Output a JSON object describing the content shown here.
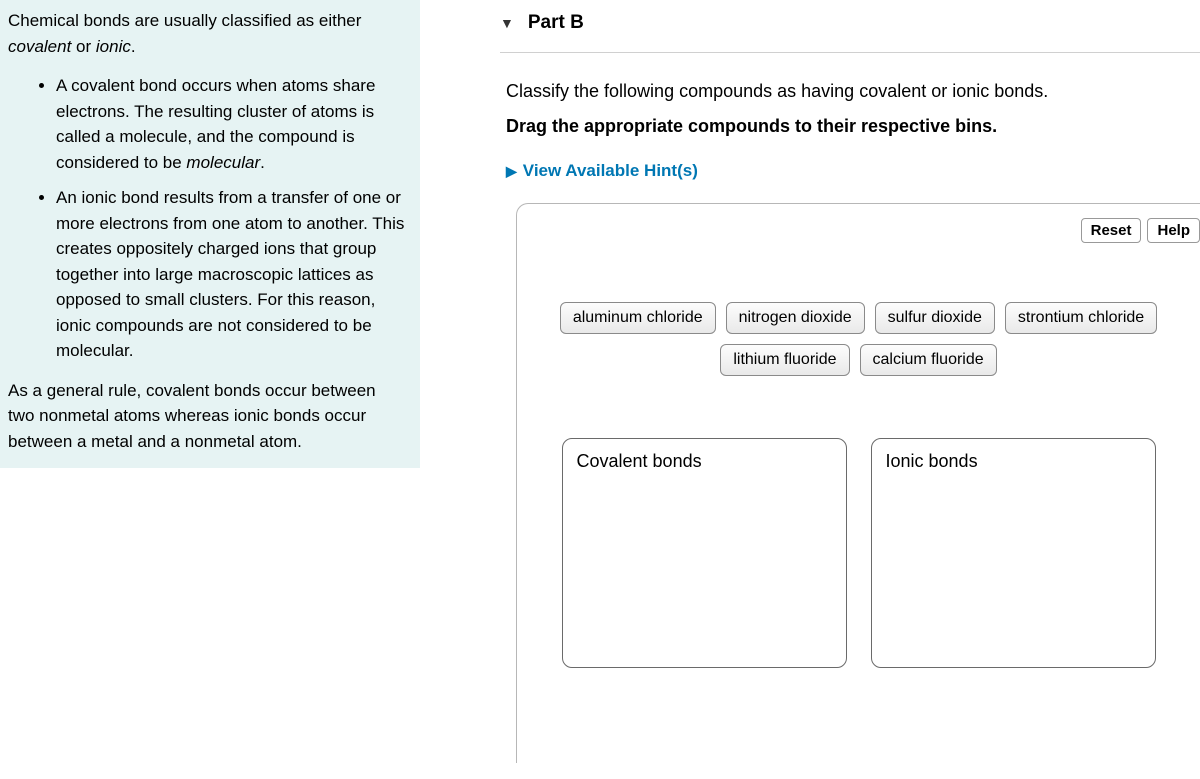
{
  "left": {
    "intro_html": "Chemical bonds are usually classified as either <em>covalent</em> or <em>ionic</em>.",
    "b1_html": "A covalent bond occurs when atoms share electrons. The resulting cluster of atoms is called a molecule, and the compound is considered to be <em>molecular</em>.",
    "b2_html": "An ionic bond results from a transfer of one or more electrons from one atom to another. This creates oppositely charged ions that group together into large macroscopic lattices as opposed to small clusters. For this reason, ionic compounds are not considered to be molecular.",
    "outro": "As a general rule, covalent bonds occur between two nonmetal atoms whereas ionic bonds occur between a metal and a nonmetal atom."
  },
  "part": {
    "label": "Part B"
  },
  "question": {
    "line1": "Classify the following compounds as having covalent or ionic bonds.",
    "line2": "Drag the appropriate compounds to their respective bins."
  },
  "hints": {
    "label": "View Available Hint(s)"
  },
  "toolbar": {
    "reset": "Reset",
    "help": "Help"
  },
  "compounds": {
    "c0": "aluminum chloride",
    "c1": "nitrogen dioxide",
    "c2": "sulfur dioxide",
    "c3": "strontium chloride",
    "c4": "lithium fluoride",
    "c5": "calcium fluoride"
  },
  "bins": {
    "covalent": "Covalent bonds",
    "ionic": "Ionic bonds"
  }
}
